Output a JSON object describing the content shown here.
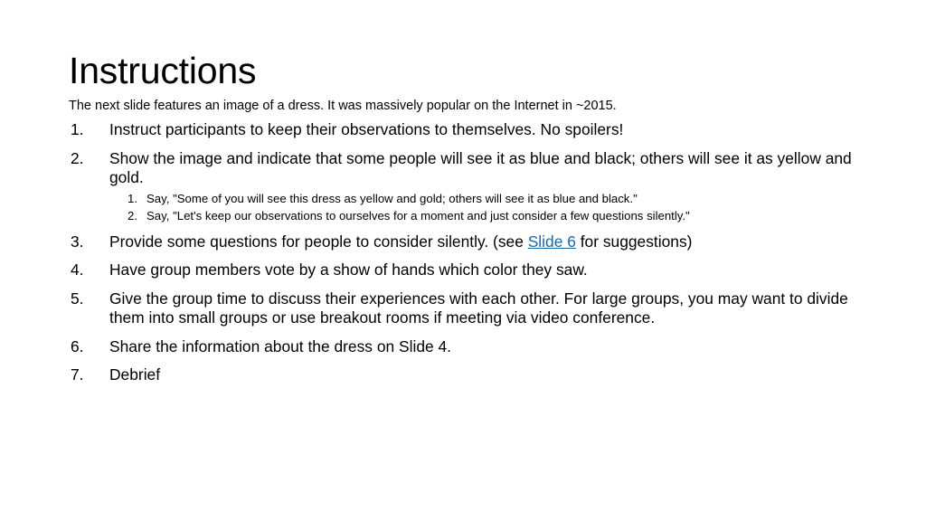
{
  "slide": {
    "title": "Instructions",
    "subtitle": "The next slide features an image of a dress. It was massively popular on the Internet in ~2015.",
    "items": [
      {
        "marker": "1.",
        "text": "Instruct participants to keep their observations to themselves. No spoilers!"
      },
      {
        "marker": "2.",
        "text": " Show the image and indicate that some people will see it as blue and black; others will see it as yellow and gold.",
        "subitems": [
          {
            "marker": "1.",
            "text": "Say, \"Some of you will see this dress as yellow and gold; others will see it as blue and black.\""
          },
          {
            "marker": "2.",
            "text": "Say, \"Let's keep our observations to ourselves for a moment and just consider a few questions silently.\""
          }
        ]
      },
      {
        "marker": "3.",
        "text_before_link": "Provide some questions for people to consider silently. (see ",
        "link_label": "Slide 6",
        "text_after_link": " for suggestions)"
      },
      {
        "marker": "4.",
        "text": "Have group members vote by a show of hands which color they saw."
      },
      {
        "marker": "5.",
        "text": "Give the group time to discuss their experiences with each other. For large groups, you may want to divide them into small groups or use breakout rooms if meeting via video conference."
      },
      {
        "marker": "6.",
        "text": "Share the information about the dress on Slide 4."
      },
      {
        "marker": "7.",
        "text": "Debrief"
      }
    ]
  },
  "colors": {
    "background": "#ffffff",
    "text": "#000000",
    "hyperlink": "#1769aa"
  }
}
